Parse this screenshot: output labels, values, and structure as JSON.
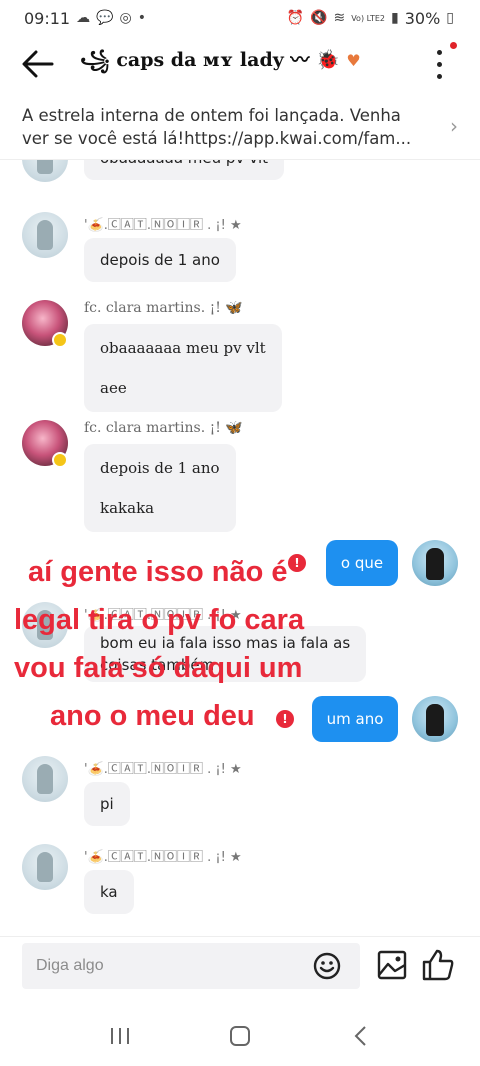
{
  "status_bar": {
    "time": "09:11",
    "battery": "30%",
    "network": "Vo) LTE2"
  },
  "header": {
    "title": "caps da ᴍʏ lady",
    "back_icon": "arrow-left-icon",
    "more_icon": "more-vertical-icon"
  },
  "announcement": {
    "text": "A estrela interna de ontem foi lançada. Venha ver se você está lá!https://app.kwai.com/fam..."
  },
  "messages": [
    {
      "sender": "",
      "lines": [
        "obaaaaaaa meu pv vlt"
      ]
    },
    {
      "sender": "'🍝.🄲🄰🅃.🄽🄾🄸🅁 . ¡! ★",
      "lines": [
        "depois de 1 ano"
      ]
    },
    {
      "sender": "fc. clara martins. ¡! 🦋",
      "lines": [
        "obaaaaaaa meu pv vlt",
        "aee"
      ]
    },
    {
      "sender": "fc. clara martins. ¡! 🦋",
      "lines": [
        "depois de 1 ano",
        "kakaka"
      ]
    },
    {
      "sender": "",
      "lines": [
        "o que"
      ],
      "outgoing": true
    },
    {
      "sender": "'🍝.🄲🄰🅃.🄽🄾🄸🅁 . ¡! ★",
      "lines": [
        "bom eu ia fala isso mas ia fala as",
        "coisas também"
      ]
    },
    {
      "sender": "",
      "lines": [
        "um ano"
      ],
      "outgoing": true
    },
    {
      "sender": "'🍝.🄲🄰🅃.🄽🄾🄸🅁 . ¡! ★",
      "lines": [
        "pi"
      ]
    },
    {
      "sender": "'🍝.🄲🄰🅃.🄽🄾🄸🅁 . ¡! ★",
      "lines": [
        "ka"
      ]
    }
  ],
  "overlay_caption": [
    "aí gente isso não é",
    "legal tira o pv fo cara",
    "vou fala só daqui um",
    "ano o meu deu"
  ],
  "input": {
    "placeholder": "Diga algo"
  },
  "colors": {
    "accent_blue": "#1e90f0",
    "caption_red": "#e8293a",
    "bubble_gray": "#f2f2f4"
  }
}
